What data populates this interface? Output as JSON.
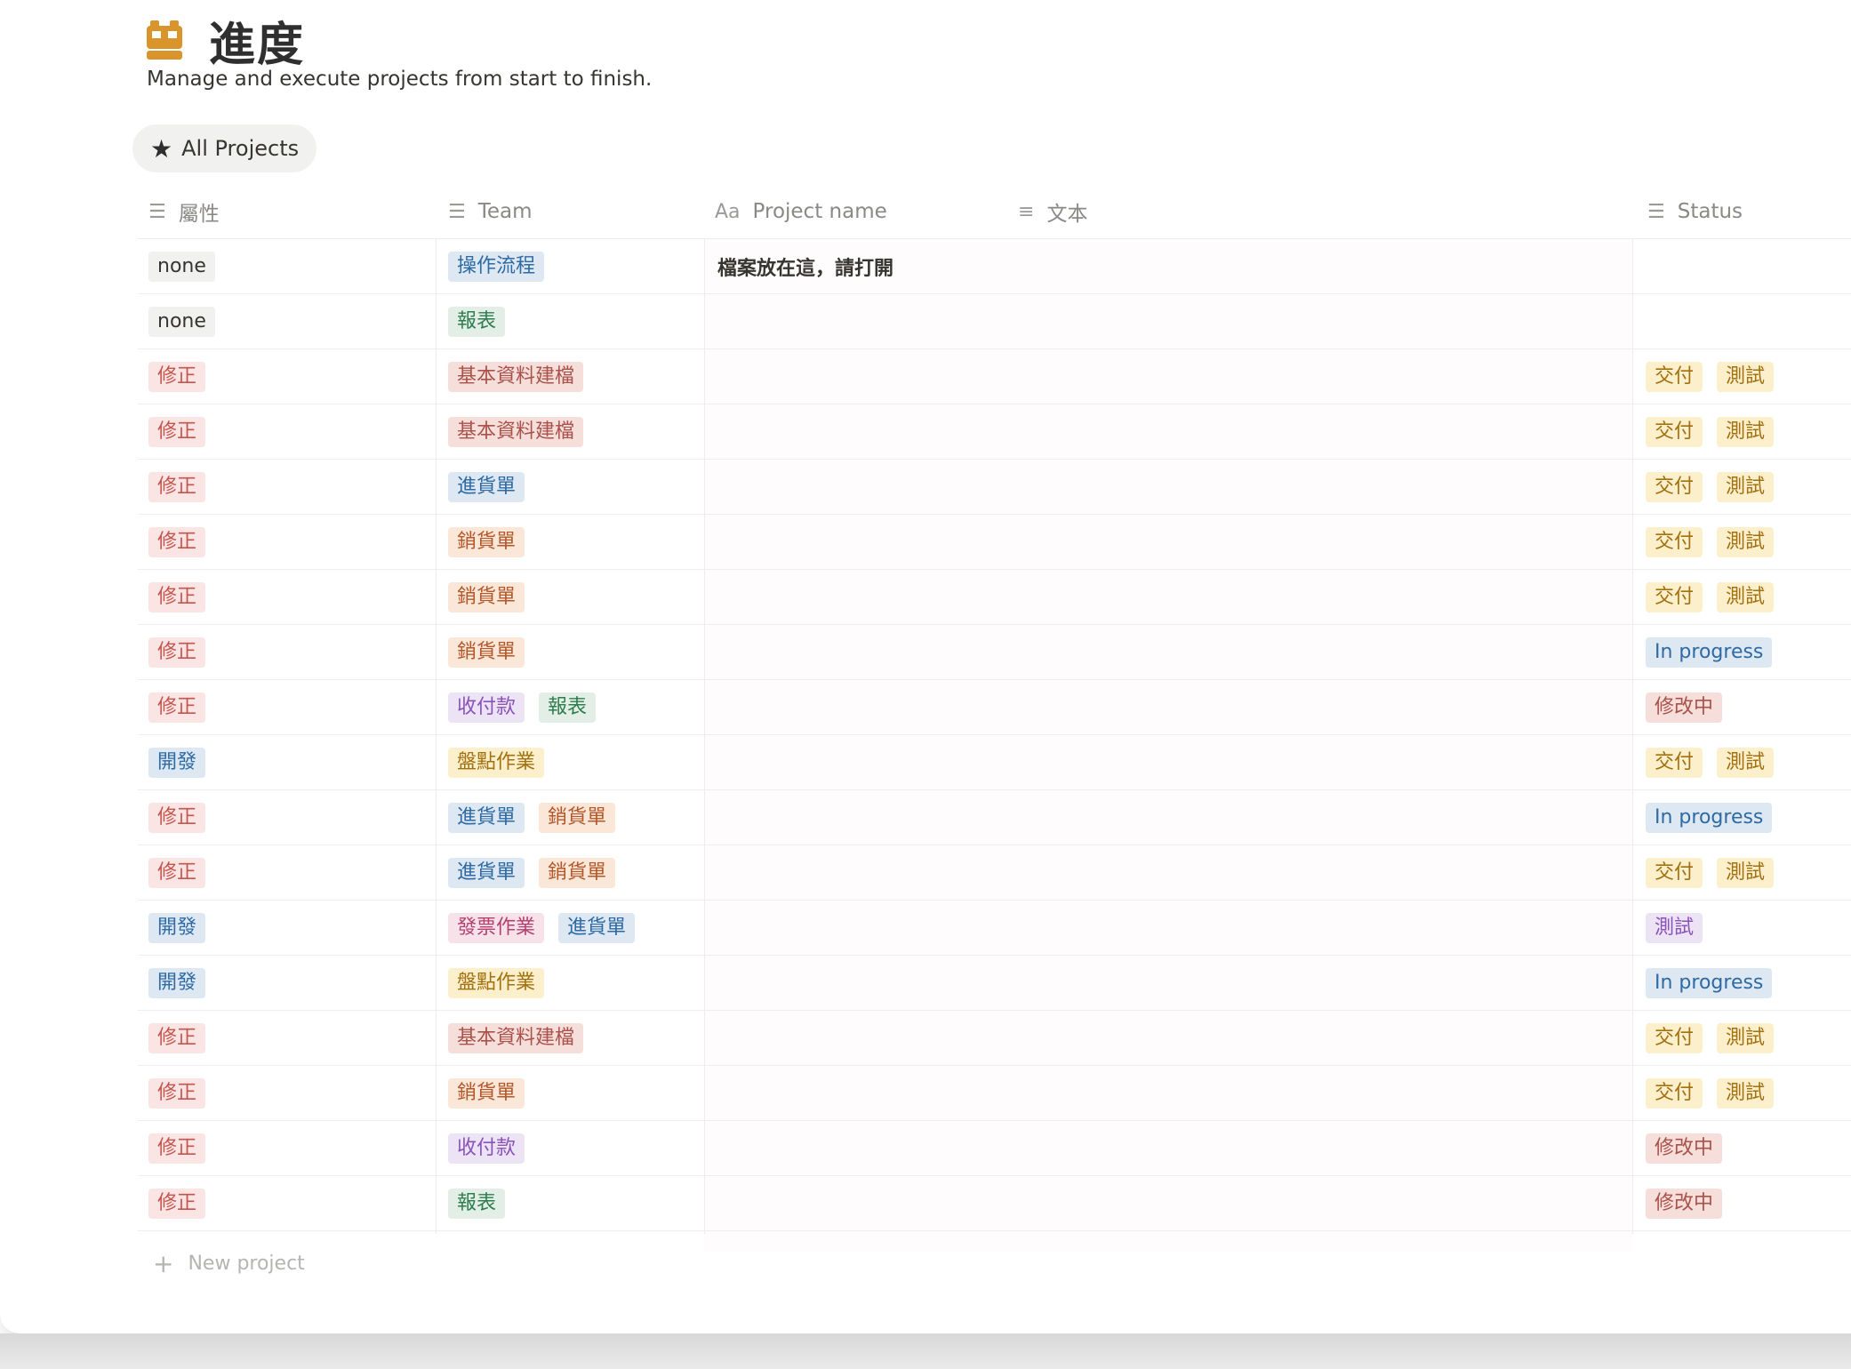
{
  "page": {
    "icon": "calendar-face-icon",
    "title": "進度",
    "subtitle": "Manage and execute projects from start to finish."
  },
  "view_tab": {
    "icon": "star-icon",
    "label": "All Projects"
  },
  "columns": [
    {
      "key": "attr",
      "label": "屬性",
      "icon": "list-icon"
    },
    {
      "key": "team",
      "label": "Team",
      "icon": "list-icon"
    },
    {
      "key": "name",
      "label": "Project name",
      "icon": "title-icon"
    },
    {
      "key": "text",
      "label": "文本",
      "icon": "text-lines-icon"
    },
    {
      "key": "status",
      "label": "Status",
      "icon": "list-icon"
    }
  ],
  "colors": {
    "default": "#f1f1ef",
    "red": "#fbe4e4",
    "blue": "#dde8f3",
    "green": "#e3efe6",
    "orange": "#fbe7d8",
    "yellow": "#fcefcc",
    "purple": "#ece3f5"
  },
  "rows": [
    {
      "attr": {
        "label": "none",
        "color": "default"
      },
      "team": [
        {
          "label": "操作流程",
          "color": "blue"
        }
      ],
      "name": "檔案放在這，請打開",
      "status": []
    },
    {
      "attr": {
        "label": "none",
        "color": "default"
      },
      "team": [
        {
          "label": "報表",
          "color": "green"
        }
      ],
      "name": "",
      "status": []
    },
    {
      "attr": {
        "label": "修正",
        "color": "red"
      },
      "team": [
        {
          "label": "基本資料建檔",
          "color": "brownred"
        }
      ],
      "name": "",
      "status": [
        {
          "label": "交付",
          "color": "yellow"
        },
        {
          "label": "測試",
          "color": "yellow"
        }
      ]
    },
    {
      "attr": {
        "label": "修正",
        "color": "red"
      },
      "team": [
        {
          "label": "基本資料建檔",
          "color": "brownred"
        }
      ],
      "name": "",
      "status": [
        {
          "label": "交付",
          "color": "yellow"
        },
        {
          "label": "測試",
          "color": "yellow"
        }
      ]
    },
    {
      "attr": {
        "label": "修正",
        "color": "red"
      },
      "team": [
        {
          "label": "進貨單",
          "color": "blue"
        }
      ],
      "name": "",
      "status": [
        {
          "label": "交付",
          "color": "yellow"
        },
        {
          "label": "測試",
          "color": "yellow"
        }
      ]
    },
    {
      "attr": {
        "label": "修正",
        "color": "red"
      },
      "team": [
        {
          "label": "銷貨單",
          "color": "orange"
        }
      ],
      "name": "",
      "status": [
        {
          "label": "交付",
          "color": "yellow"
        },
        {
          "label": "測試",
          "color": "yellow"
        }
      ]
    },
    {
      "attr": {
        "label": "修正",
        "color": "red"
      },
      "team": [
        {
          "label": "銷貨單",
          "color": "orange"
        }
      ],
      "name": "",
      "status": [
        {
          "label": "交付",
          "color": "yellow"
        },
        {
          "label": "測試",
          "color": "yellow"
        }
      ]
    },
    {
      "attr": {
        "label": "修正",
        "color": "red"
      },
      "team": [
        {
          "label": "銷貨單",
          "color": "orange"
        }
      ],
      "name": "",
      "status": [
        {
          "label": "In progress",
          "color": "blue"
        }
      ]
    },
    {
      "attr": {
        "label": "修正",
        "color": "red"
      },
      "team": [
        {
          "label": "收付款",
          "color": "purple"
        },
        {
          "label": "報表",
          "color": "green"
        }
      ],
      "name": "",
      "status": [
        {
          "label": "修改中",
          "color": "brownred"
        }
      ]
    },
    {
      "attr": {
        "label": "開發",
        "color": "blue"
      },
      "team": [
        {
          "label": "盤點作業",
          "color": "yellow"
        }
      ],
      "name": "",
      "status": [
        {
          "label": "交付",
          "color": "yellow"
        },
        {
          "label": "測試",
          "color": "yellow"
        }
      ]
    },
    {
      "attr": {
        "label": "修正",
        "color": "red"
      },
      "team": [
        {
          "label": "進貨單",
          "color": "blue"
        },
        {
          "label": "銷貨單",
          "color": "orange"
        }
      ],
      "name": "",
      "status": [
        {
          "label": "In progress",
          "color": "blue"
        }
      ]
    },
    {
      "attr": {
        "label": "修正",
        "color": "red"
      },
      "team": [
        {
          "label": "進貨單",
          "color": "blue"
        },
        {
          "label": "銷貨單",
          "color": "orange"
        }
      ],
      "name": "",
      "status": [
        {
          "label": "交付",
          "color": "yellow"
        },
        {
          "label": "測試",
          "color": "yellow"
        }
      ]
    },
    {
      "attr": {
        "label": "開發",
        "color": "blue"
      },
      "team": [
        {
          "label": "發票作業",
          "color": "pink"
        },
        {
          "label": "進貨單",
          "color": "blue"
        }
      ],
      "name": "",
      "status": [
        {
          "label": "測試",
          "color": "purple"
        }
      ]
    },
    {
      "attr": {
        "label": "開發",
        "color": "blue"
      },
      "team": [
        {
          "label": "盤點作業",
          "color": "yellow"
        }
      ],
      "name": "",
      "status": [
        {
          "label": "In progress",
          "color": "blue"
        }
      ]
    },
    {
      "attr": {
        "label": "修正",
        "color": "red"
      },
      "team": [
        {
          "label": "基本資料建檔",
          "color": "brownred"
        }
      ],
      "name": "",
      "status": [
        {
          "label": "交付",
          "color": "yellow"
        },
        {
          "label": "測試",
          "color": "yellow"
        }
      ]
    },
    {
      "attr": {
        "label": "修正",
        "color": "red"
      },
      "team": [
        {
          "label": "銷貨單",
          "color": "orange"
        }
      ],
      "name": "",
      "status": [
        {
          "label": "交付",
          "color": "yellow"
        },
        {
          "label": "測試",
          "color": "yellow"
        }
      ]
    },
    {
      "attr": {
        "label": "修正",
        "color": "red"
      },
      "team": [
        {
          "label": "收付款",
          "color": "purple"
        }
      ],
      "name": "",
      "status": [
        {
          "label": "修改中",
          "color": "brownred"
        }
      ]
    },
    {
      "attr": {
        "label": "修正",
        "color": "red"
      },
      "team": [
        {
          "label": "報表",
          "color": "green"
        }
      ],
      "name": "",
      "status": [
        {
          "label": "修改中",
          "color": "brownred"
        }
      ]
    }
  ],
  "new_project_label": "New project"
}
